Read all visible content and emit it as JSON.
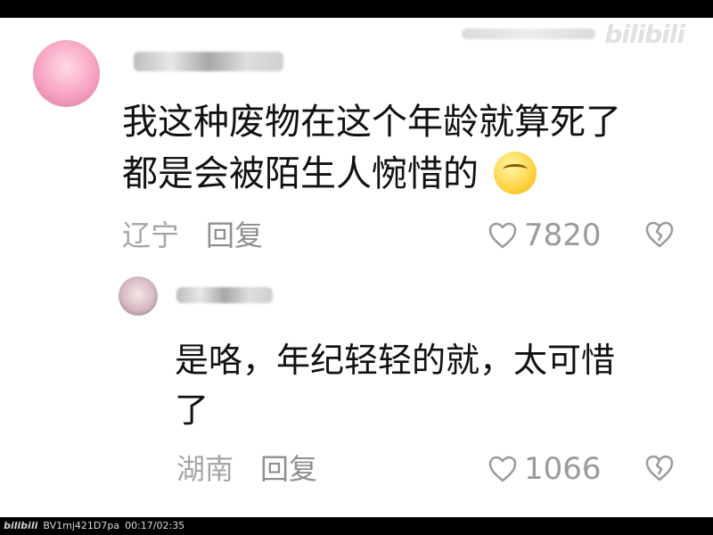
{
  "watermark": {
    "logo": "bilibili"
  },
  "comments": [
    {
      "text_line1": "我这种废物在这个年龄就算死了",
      "text_line2": "都是会被陌生人惋惜的",
      "location": "辽宁",
      "reply_label": "回复",
      "likes": "7820"
    },
    {
      "text_line1": "是咯，年纪轻轻的就，太可惜",
      "text_line2": "了",
      "location": "湖南",
      "reply_label": "回复",
      "likes": "1066"
    }
  ],
  "bottom_bar": {
    "logo": "bilibili",
    "video_id": "BV1mj421D7pa",
    "time": "00:17/02:35"
  },
  "colors": {
    "background": "#ffffff",
    "text_primary": "#111111",
    "text_meta": "#a6a6a6",
    "bar": "#000000"
  },
  "icons": [
    "heart-outline-icon",
    "broken-heart-icon",
    "emoji-smug-icon"
  ]
}
